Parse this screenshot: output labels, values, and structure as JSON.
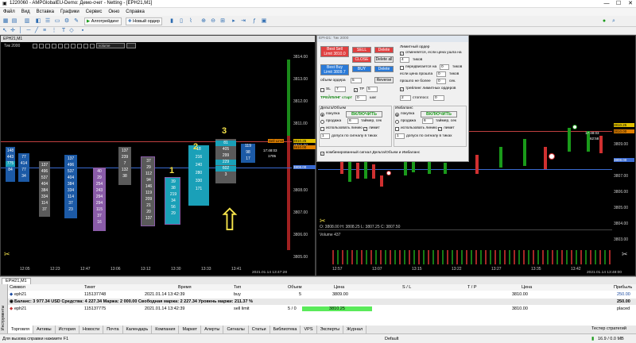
{
  "window": {
    "title": "1220060 - AMPGlobalEU-Demo: Демо-счет - Netting - [EPH21,M1]",
    "minimize": "—",
    "maximize": "☐",
    "close": "✕"
  },
  "menu": [
    "Файл",
    "Вид",
    "Вставка",
    "Графики",
    "Сервис",
    "Окно",
    "Справка"
  ],
  "toolbar": {
    "algo_label": "Алготрейдинг",
    "new_order_label": "Новый ордер"
  },
  "left_chart": {
    "title": "EPH21,M1",
    "tick_label": "Тик 2000",
    "volume_select": "volume",
    "price_labels": [
      "3814.00",
      "3813.00",
      "3812.00",
      "3811.00",
      "3810.00",
      "3809.00",
      "3808.00",
      "3807.00",
      "3806.00",
      "3805.00"
    ],
    "sell_limit_tag": "Sell Limit",
    "sell_limit_price": "3810.25",
    "current_tag_1": "3810.00",
    "current_tag_2": "3808.00",
    "time_readout": "17:48:03",
    "count_readout": "1705",
    "x_labels": [
      "12:05",
      "12:23",
      "12:47",
      "13:06",
      "13:12",
      "13:30",
      "13:33",
      "13:41"
    ],
    "footer_time": "2021.01.14 13:47:28",
    "num1": "1",
    "num2": "2",
    "num3": "3",
    "arrow": "⇧",
    "cluster_values": {
      "c1": [
        "148",
        "443",
        "775",
        "84"
      ],
      "c2": [
        "77",
        "414",
        "77",
        "34"
      ],
      "c3": [
        "137",
        "496",
        "537",
        "404",
        "384",
        "334",
        "114",
        "37",
        "23"
      ],
      "c4": [
        "40",
        "29",
        "254",
        "243",
        "294",
        "294",
        "115",
        "37",
        "16"
      ],
      "c5": [
        "119",
        "54",
        "318",
        "242",
        "118"
      ],
      "c6": [
        "137",
        "239",
        "7",
        "132",
        "38"
      ],
      "c7": [
        "37",
        "29",
        "112",
        "94",
        "146",
        "119",
        "209",
        "21",
        "20",
        "137"
      ],
      "c8": [
        "39",
        "38",
        "219",
        "34",
        "56",
        "29"
      ],
      "c9": [
        "18",
        "216",
        "240",
        "280",
        "330",
        "171"
      ],
      "c10": [
        "81",
        "405",
        "299",
        "229",
        "602",
        "3"
      ],
      "c11": [
        "119",
        "98",
        "17"
      ]
    }
  },
  "dialog": {
    "title": "EPH21: Тик 2000",
    "best_sell": "Best Sell",
    "best_sell_limit": "Limit 3810.0",
    "sell": "SELL",
    "delete1": "Delete",
    "close": "CLOSE",
    "delete_all": "Delete all",
    "best_buy": "Best Buy",
    "best_buy_limit": "Limit 3809.7",
    "buy": "BUY",
    "delete2": "Delete",
    "volume_label": "объем ордера",
    "volume_value": "5",
    "reverse": "Reverse",
    "sl": "SL",
    "sl_value": "7",
    "tp": "TP",
    "tp_value": "5",
    "trailing_label": "ТРЕЙЛИНГ старт",
    "trailing_value": "0",
    "step_label": "шаг",
    "step_value": "2",
    "stoploss_label": "стоплосс",
    "stoploss_value": "0",
    "delta_section": "Дельта/Объем",
    "delta_enable": "ВКЛЮЧИТЬ",
    "imbalance_section": "Имбаланс",
    "imbalance_enable": "ВКЛЮЧИТЬ",
    "buy_opt": "покупка",
    "sell_opt": "продажа",
    "timer_label": "таймер, сек",
    "timer_value_1": "6",
    "timer_value_2": "6",
    "use_line": "использовать линию",
    "limit_label": "лимит",
    "ticks_label": "допуск по сигналу в тиках",
    "ticks_value": "1",
    "combined": "комбинированный сигнал Дельта/Объем и Имбаланс",
    "limit_order_title": "Лимитный ордер",
    "lo_1": "отменяется, если цена ушла на",
    "lo_1_value": "4",
    "lo_ticks": "тиков",
    "lo_2": "передвигается на",
    "lo_2_value": "0",
    "lo_3": "если цена прошла",
    "lo_3_value": "0",
    "lo_4": "прошло не более",
    "lo_4_value": "0",
    "lo_sec": "сек.",
    "lo_5": "трейлинг лимитных ордеров"
  },
  "right_chart": {
    "price_labels": [
      "3810.25",
      "3810.00",
      "3809.00",
      "3808.00",
      "3807.00",
      "3806.00",
      "3805.00",
      "3804.00",
      "3803.00"
    ],
    "ohlc": "O: 3808.00  H: 3808.25  L: 3807.25  C: 3807.50",
    "volume_label": "Volume 437",
    "time_readout": "17:48:03",
    "count_readout": "62:58",
    "x_labels": [
      "12:57",
      "13:07",
      "13:15",
      "13:22",
      "13:27",
      "13:35",
      "13:42"
    ],
    "footer_time": "2021.01.14 13:48:00"
  },
  "tab": {
    "label": "EPH21,M1"
  },
  "table": {
    "headers": [
      "Символ",
      "Тикет",
      "Время",
      "Тип",
      "Объем",
      "Цена",
      "S / L",
      "T / P",
      "Цена",
      "Прибыль"
    ],
    "row1": [
      "eph21",
      "115137748",
      "2021.01.14 13:42:39",
      "buy",
      "5",
      "3809.00",
      "",
      "",
      "3810.00",
      "250.00"
    ],
    "summary": "Баланс: 3 977.34 USD  Средства: 4 227.34  Маржа: 2 000.00  Свободная маржа: 2 227.34  Уровень маржи: 211.37 %",
    "summary_profit": "250.00",
    "row2": [
      "eph21",
      "115137775",
      "2021.01.14 13:42:39",
      "sell limit",
      "5 / 0",
      "3810.25",
      "",
      "",
      "3810.00",
      "placed"
    ]
  },
  "bottom_tabs": [
    "Торговля",
    "Активы",
    "История",
    "Новости",
    "Почта",
    "Календарь",
    "Компания",
    "Маркет",
    "Алерты",
    "Сигналы",
    "Статьи",
    "Библиотека",
    "VPS",
    "Эксперты",
    "Журнал"
  ],
  "side_label": "Инструменты",
  "strategy_tester": "Тестер стратегий",
  "status": {
    "help": "Для вызова справки нажмите F1",
    "profile": "Default",
    "connection": "16.9 / 0.0 MB"
  },
  "colors": {
    "cluster_blue": "#1c5aa6",
    "cluster_teal": "#1aa0b8",
    "cluster_gray": "#5a5a5a",
    "cluster_purple": "#8a5ca8",
    "num_yellow": "#f5e34a"
  }
}
